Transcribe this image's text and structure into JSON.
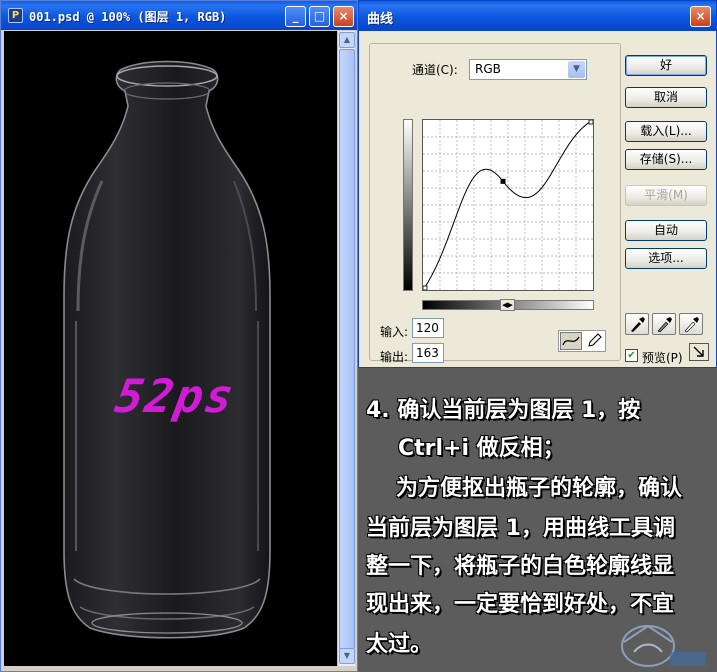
{
  "document_window": {
    "title": "001.psd @ 100% (图层 1, RGB)",
    "buttons": {
      "minimize": "_",
      "maximize": "□",
      "close": "×"
    },
    "watermark": "52ps"
  },
  "curves_dialog": {
    "title": "曲线",
    "channel_label": "通道(C):",
    "channel_value": "RGB",
    "input_label": "输入:",
    "input_value": "120",
    "output_label": "输出:",
    "output_value": "163",
    "buttons": {
      "ok": "好",
      "cancel": "取消",
      "load": "载入(L)...",
      "save": "存储(S)...",
      "smooth": "平滑(M)",
      "auto": "自动",
      "options": "选项..."
    },
    "preview_label": "预览(P)",
    "preview_checked": true,
    "curve_point": {
      "input": 120,
      "output": 163
    },
    "curve_range": [
      0,
      255
    ]
  },
  "tutorial_text": {
    "lines": [
      "4. 确认当前层为图层 1，按",
      "Ctrl+i 做反相；",
      "为方便抠出瓶子的轮廓，确认",
      "当前层为图层 1，用曲线工具调",
      "整一下，将瓶子的白色轮廓线显",
      "现出来，一定要恰到好处，不宜",
      "太过。"
    ]
  },
  "icons": {
    "app": "photoshop-document-icon",
    "curve_tool": "curve-point-tool-icon",
    "pencil_tool": "pencil-tool-icon",
    "black_eyedropper": "black-eyedropper-icon",
    "gray_eyedropper": "gray-eyedropper-icon",
    "white_eyedropper": "white-eyedropper-icon",
    "expand": "expand-dialog-icon"
  },
  "colors": {
    "titlebar": "#0a5de8",
    "watermark": "#d21bd6",
    "panel_bg": "#5c5c5c"
  }
}
